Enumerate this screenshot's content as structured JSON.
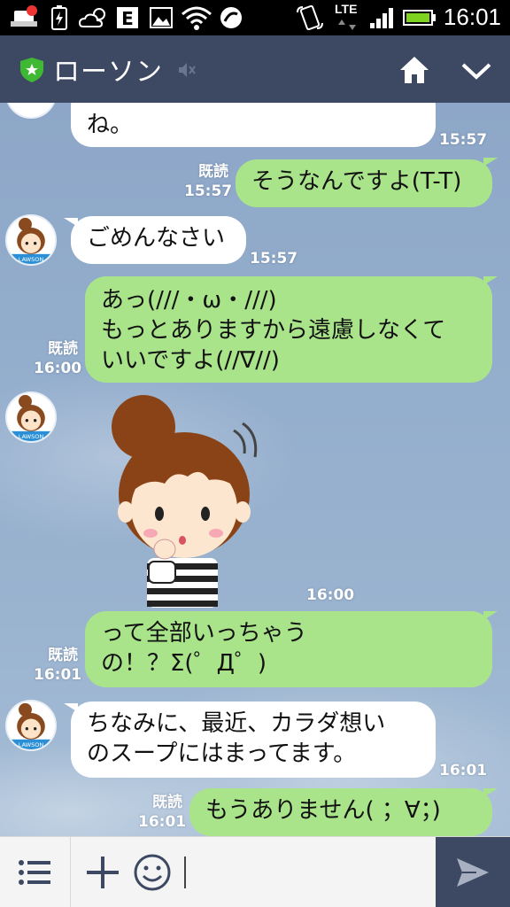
{
  "status_bar": {
    "time": "16:01",
    "network": "LTE"
  },
  "header": {
    "title": "ローソン",
    "icons": [
      "shield-star-icon",
      "mute-icon",
      "home-icon",
      "chevron-down-icon"
    ]
  },
  "messages": [
    {
      "side": "in",
      "text": "ね。",
      "time": "15:57",
      "read": ""
    },
    {
      "side": "out",
      "text": "そうなんですよ(T-T)",
      "time": "15:57",
      "read": "既読"
    },
    {
      "side": "in",
      "text": "ごめんなさい",
      "time": "15:57",
      "read": ""
    },
    {
      "side": "out",
      "text": "あっ(///・ω・///)\nもっとありますから遠慮しなくて\nいいですよ(//∇//)",
      "time": "16:00",
      "read": "既読"
    },
    {
      "side": "in",
      "type": "sticker",
      "sticker": "girl-thinking-sticker",
      "time": "16:00"
    },
    {
      "side": "out",
      "text": "って全部いっちゃう\nの！？Σ(゜Д゜)",
      "time": "16:01",
      "read": "既読"
    },
    {
      "side": "in",
      "text": "ちなみに、最近、カラダ想い\nのスープにはまってます。",
      "time": "16:01",
      "read": ""
    },
    {
      "side": "out",
      "text": "もうありません( ；∀；)",
      "time": "16:01",
      "read": "既読"
    }
  ],
  "avatar_label": "LAWSON",
  "input_bar": {
    "icons": [
      "menu-list-icon",
      "plus-icon",
      "emoji-icon",
      "send-icon"
    ],
    "value": ""
  },
  "colors": {
    "header": "#3d4863",
    "outgoing_bubble": "#a9e48a",
    "incoming_bubble": "#ffffff",
    "chat_background": "#94aecd"
  }
}
